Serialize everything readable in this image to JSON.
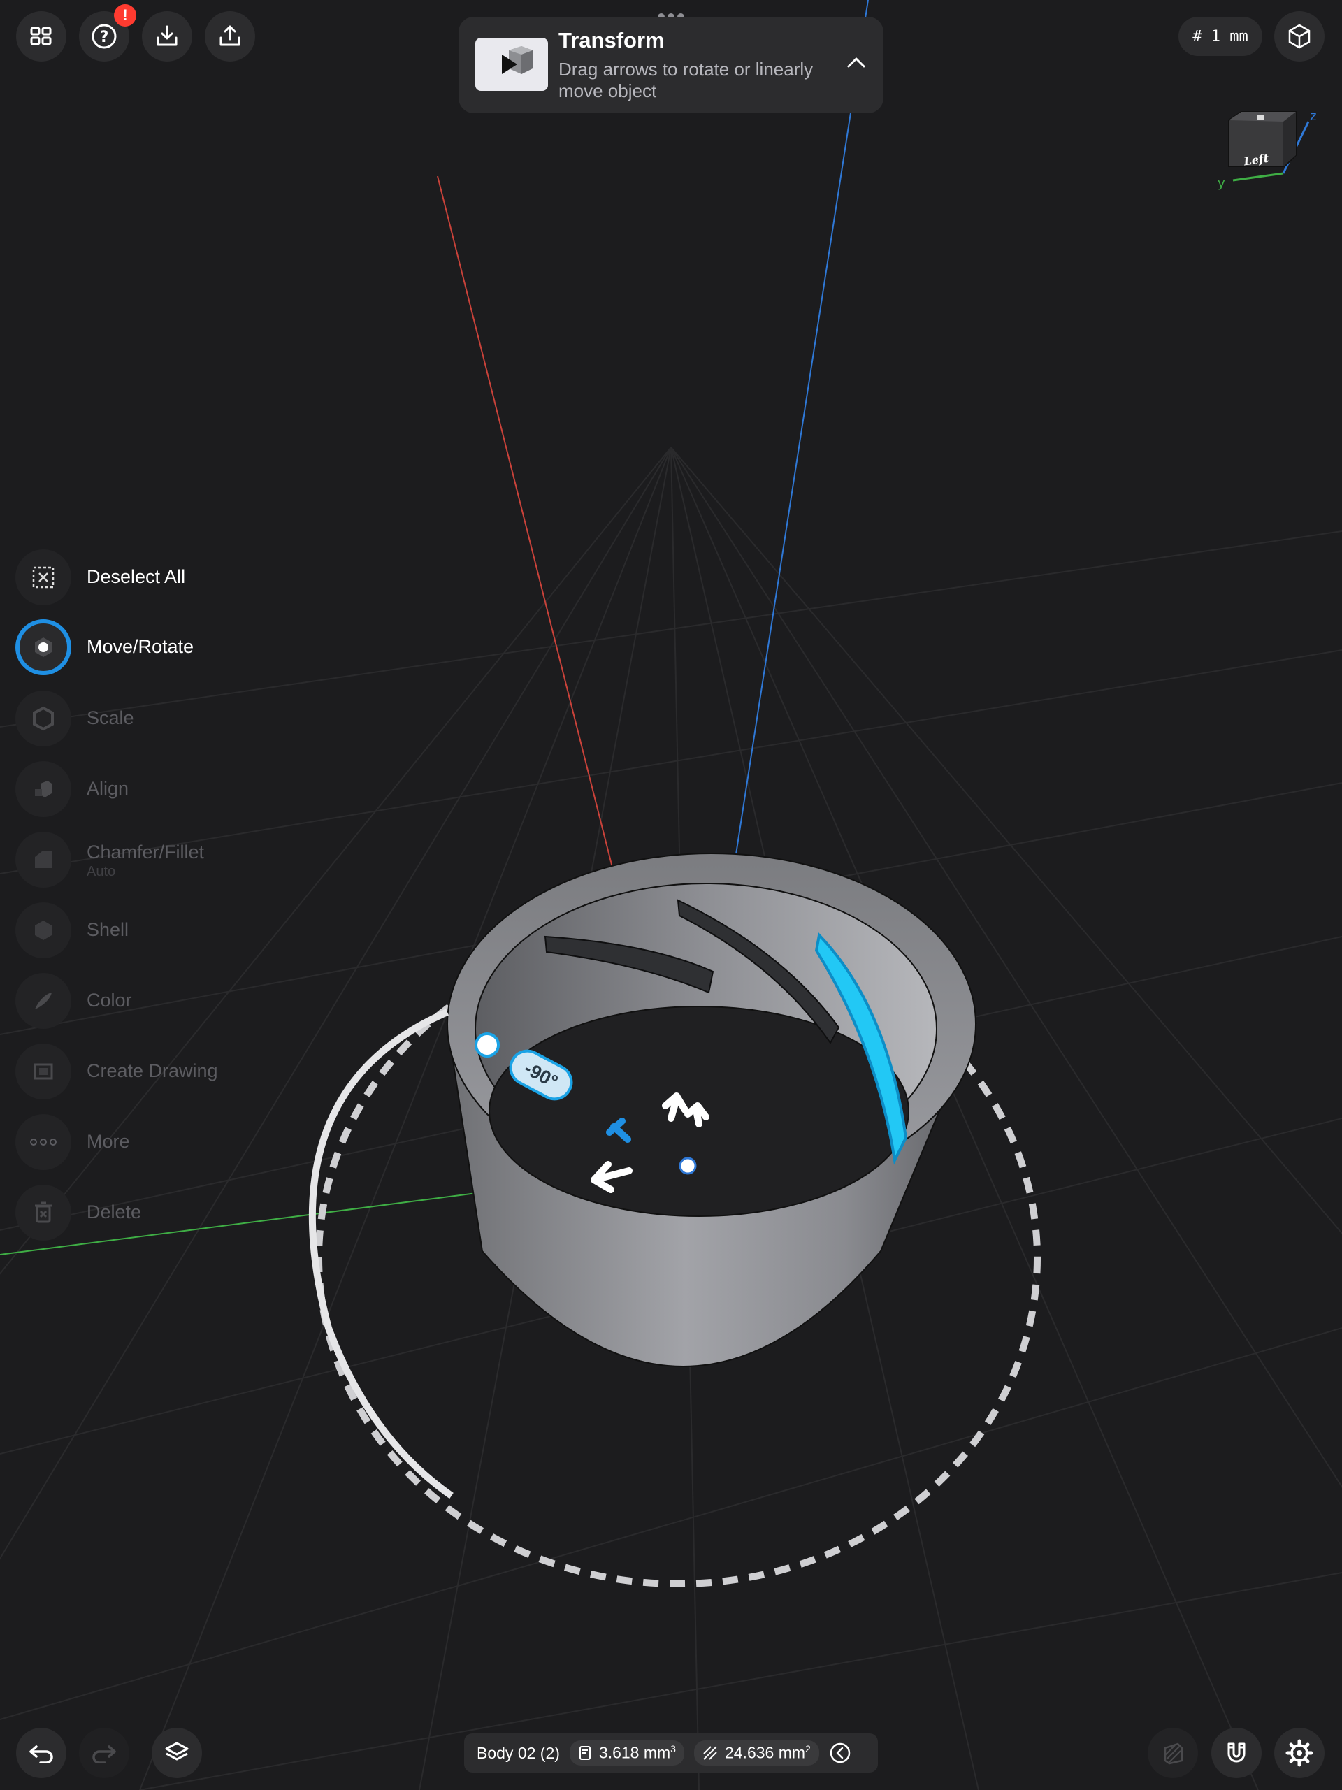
{
  "toolbar": {
    "apps_icon": "grid-icon",
    "help_icon": "help-icon",
    "help_badge": "!",
    "import_icon": "import-icon",
    "export_icon": "share-icon"
  },
  "transform_panel": {
    "title": "Transform",
    "description": "Drag arrows to rotate or linearly move object",
    "collapse_icon": "chevron-up-icon"
  },
  "grid_setting": {
    "label": "# 1 mm"
  },
  "view_cube": {
    "face_label": "Left",
    "axes": {
      "z": "z",
      "y": "y"
    },
    "colors": {
      "x": "#e0453a",
      "y": "#3fb54a",
      "z": "#2f7fe0"
    }
  },
  "side_menu": {
    "items": [
      {
        "label": "Deselect All",
        "icon": "deselect-icon",
        "state": "enabled"
      },
      {
        "label": "Move/Rotate",
        "icon": "move-rotate-icon",
        "state": "active"
      },
      {
        "label": "Scale",
        "icon": "scale-icon",
        "state": "disabled"
      },
      {
        "label": "Align",
        "icon": "align-icon",
        "state": "disabled"
      },
      {
        "label": "Chamfer/Fillet",
        "sublabel": "Auto",
        "icon": "chamfer-icon",
        "state": "disabled"
      },
      {
        "label": "Shell",
        "icon": "shell-icon",
        "state": "disabled"
      },
      {
        "label": "Color",
        "icon": "color-icon",
        "state": "disabled"
      },
      {
        "label": "Create Drawing",
        "icon": "drawing-icon",
        "state": "disabled"
      },
      {
        "label": "More",
        "icon": "more-icon",
        "state": "disabled"
      },
      {
        "label": "Delete",
        "icon": "trash-icon",
        "state": "disabled"
      }
    ]
  },
  "viewport": {
    "rotation_angle": "-90°",
    "accent_color": "#1aa3e6",
    "selection_color": "#22c8f5"
  },
  "status_bar": {
    "body_name": "Body 02 (2)",
    "volume": "3.618 mm",
    "volume_unit_power": "3",
    "area": "24.636 mm",
    "area_unit_power": "2"
  },
  "bottom_toolbar": {
    "undo_icon": "undo-icon",
    "redo_icon": "redo-icon",
    "layers_icon": "layers-icon",
    "section_icon": "section-view-icon",
    "snap_icon": "magnet-icon",
    "settings_icon": "settings-icon"
  }
}
